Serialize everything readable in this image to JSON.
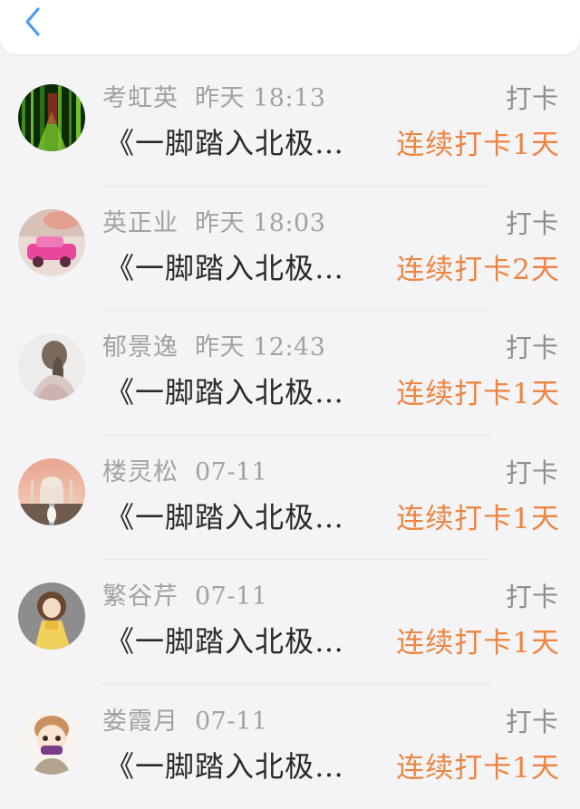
{
  "header": {
    "back_icon": "chevron-left-icon",
    "accent": "#4a9cf0"
  },
  "colors": {
    "streak": "#ee8440",
    "meta": "#a2a2a2",
    "title": "#2a2a2a"
  },
  "items": [
    {
      "name": "考虹英",
      "time": "昨天 18:13",
      "checkin_label": "打卡",
      "title": "《一脚踏入北极…",
      "streak": "连续打卡1天",
      "avatar": "bamboo-forest-avatar"
    },
    {
      "name": "英正业",
      "time": "昨天 18:03",
      "checkin_label": "打卡",
      "title": "《一脚踏入北极…",
      "streak": "连续打卡2天",
      "avatar": "pink-car-avatar"
    },
    {
      "name": "郁景逸",
      "time": "昨天 12:43",
      "checkin_label": "打卡",
      "title": "《一脚踏入北极…",
      "streak": "连续打卡1天",
      "avatar": "girl-sketch-avatar"
    },
    {
      "name": "楼灵松",
      "time": "07-11",
      "checkin_label": "打卡",
      "title": "《一脚踏入北极…",
      "streak": "连续打卡1天",
      "avatar": "taj-mahal-avatar"
    },
    {
      "name": "繁谷芹",
      "time": "07-11",
      "checkin_label": "打卡",
      "title": "《一脚踏入北极…",
      "streak": "连续打卡1天",
      "avatar": "cartoon-girl-avatar"
    },
    {
      "name": "娄霞月",
      "time": "07-11",
      "checkin_label": "打卡",
      "title": "《一脚踏入北极…",
      "streak": "连续打卡1天",
      "avatar": "masked-boy-avatar"
    }
  ]
}
